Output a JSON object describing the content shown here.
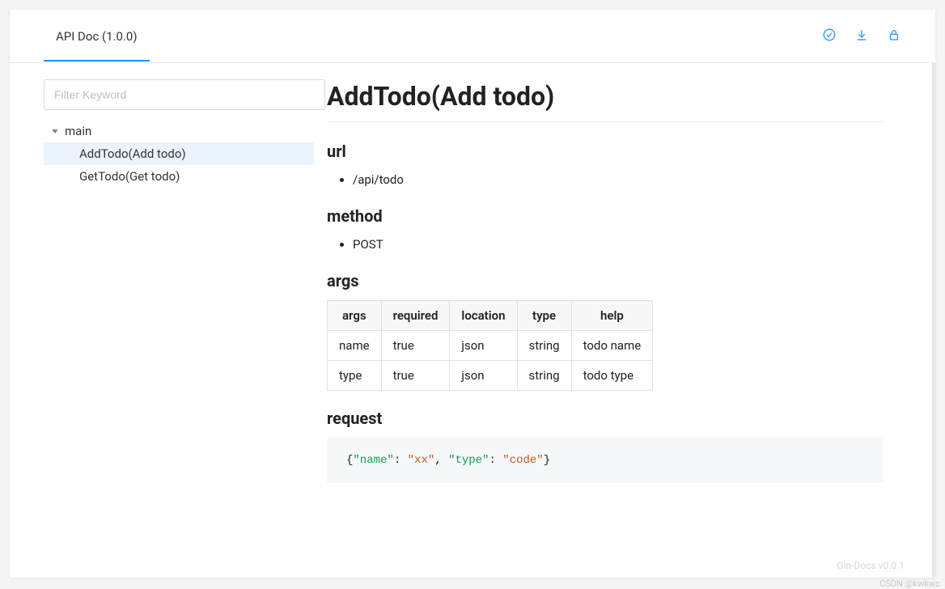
{
  "header": {
    "tab_label": "API Doc (1.0.0)"
  },
  "sidebar": {
    "filter_placeholder": "Filter Keyword",
    "root_label": "main",
    "items": [
      {
        "label": "AddTodo(Add todo)",
        "selected": true
      },
      {
        "label": "GetTodo(Get todo)",
        "selected": false
      }
    ]
  },
  "main": {
    "title": "AddTodo(Add todo)",
    "sections": {
      "url_heading": "url",
      "url_value": "/api/todo",
      "method_heading": "method",
      "method_value": "POST",
      "args_heading": "args",
      "args_table": {
        "columns": [
          "args",
          "required",
          "location",
          "type",
          "help"
        ],
        "rows": [
          [
            "name",
            "true",
            "json",
            "string",
            "todo name"
          ],
          [
            "type",
            "true",
            "json",
            "string",
            "todo type"
          ]
        ]
      },
      "request_heading": "request",
      "request_json": {
        "name": "xx",
        "type": "code"
      }
    }
  },
  "footer": {
    "app_version": "Gin-Docs v0.0.1",
    "watermark": "CSDN @kwkwc"
  }
}
